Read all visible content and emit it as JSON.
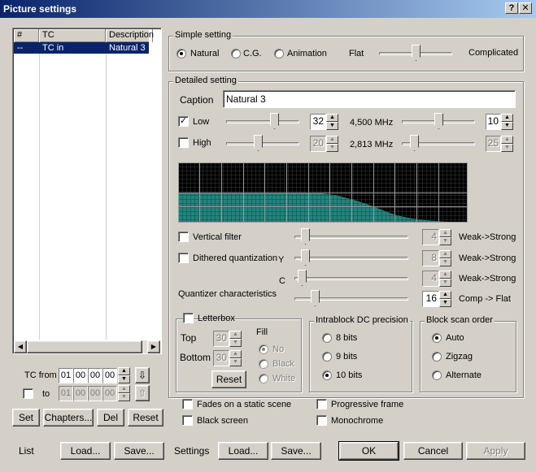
{
  "window": {
    "title": "Picture settings",
    "help_btn": "?",
    "close_btn": "X"
  },
  "list": {
    "columns": [
      "#",
      "TC",
      "Description"
    ],
    "rows": [
      {
        "num": "--",
        "tc": "TC in",
        "desc": "Natural 3"
      }
    ],
    "tc_from_label": "TC from",
    "tc_from": [
      "01",
      "00",
      "00",
      "00"
    ],
    "to_label": "to",
    "tc_to": [
      "01",
      "00",
      "00",
      "00"
    ],
    "set_btn": "Set",
    "chapters_btn": "Chapters...",
    "del_btn": "Del",
    "reset_btn": "Reset"
  },
  "simple": {
    "title": "Simple setting",
    "options": [
      "Natural",
      "C.G.",
      "Animation"
    ],
    "selected": "Natural",
    "flat_label": "Flat",
    "complicated_label": "Complicated",
    "slider_value": 0.5
  },
  "detailed": {
    "title": "Detailed setting",
    "caption_label": "Caption",
    "caption_value": "Natural 3",
    "low": {
      "label": "Low",
      "checked": true,
      "value": "32",
      "freq": "4,500 MHz",
      "value2": "10",
      "slider1": 0.6,
      "slider2": 0.5
    },
    "high": {
      "label": "High",
      "checked": false,
      "value": "20",
      "freq": "2,813 MHz",
      "value2": "25",
      "slider1": 0.4,
      "slider2": 0.15
    },
    "vertical_filter": {
      "label": "Vertical filter",
      "value": "4",
      "range": "Weak->Strong",
      "slider": 0.05
    },
    "dithered": {
      "label": "Dithered quantization",
      "y_label": "Y",
      "y_value": "8",
      "c_label": "C",
      "c_value": "4",
      "range": "Weak->Strong"
    },
    "quantizer": {
      "label": "Quantizer characteristics",
      "value": "16",
      "range": "Comp -> Flat",
      "slider": 0.15
    }
  },
  "letterbox": {
    "label": "Letterbox",
    "top_label": "Top",
    "top_value": "30",
    "bottom_label": "Bottom",
    "bottom_value": "30",
    "fill_label": "Fill",
    "fill_options": [
      "No",
      "Black",
      "White"
    ],
    "fill_selected": "No",
    "reset_btn": "Reset"
  },
  "intrablock": {
    "title": "Intrablock DC precision",
    "options": [
      "8 bits",
      "9 bits",
      "10 bits"
    ],
    "selected": "10 bits"
  },
  "blockscan": {
    "title": "Block scan order",
    "options": [
      "Auto",
      "Zigzag",
      "Alternate"
    ],
    "selected": "Auto"
  },
  "checks": {
    "fades": "Fades on a static scene",
    "black_screen": "Black screen",
    "progressive": "Progressive frame",
    "monochrome": "Monochrome"
  },
  "footer": {
    "list_label": "List",
    "list_load": "Load...",
    "list_save": "Save...",
    "settings_label": "Settings",
    "settings_load": "Load...",
    "settings_save": "Save...",
    "ok": "OK",
    "cancel": "Cancel",
    "apply": "Apply"
  },
  "colors": {
    "title_start": "#0a246a",
    "title_end": "#a6caf0",
    "graph_fill": "#20847f",
    "graph_bg": "#000000"
  }
}
